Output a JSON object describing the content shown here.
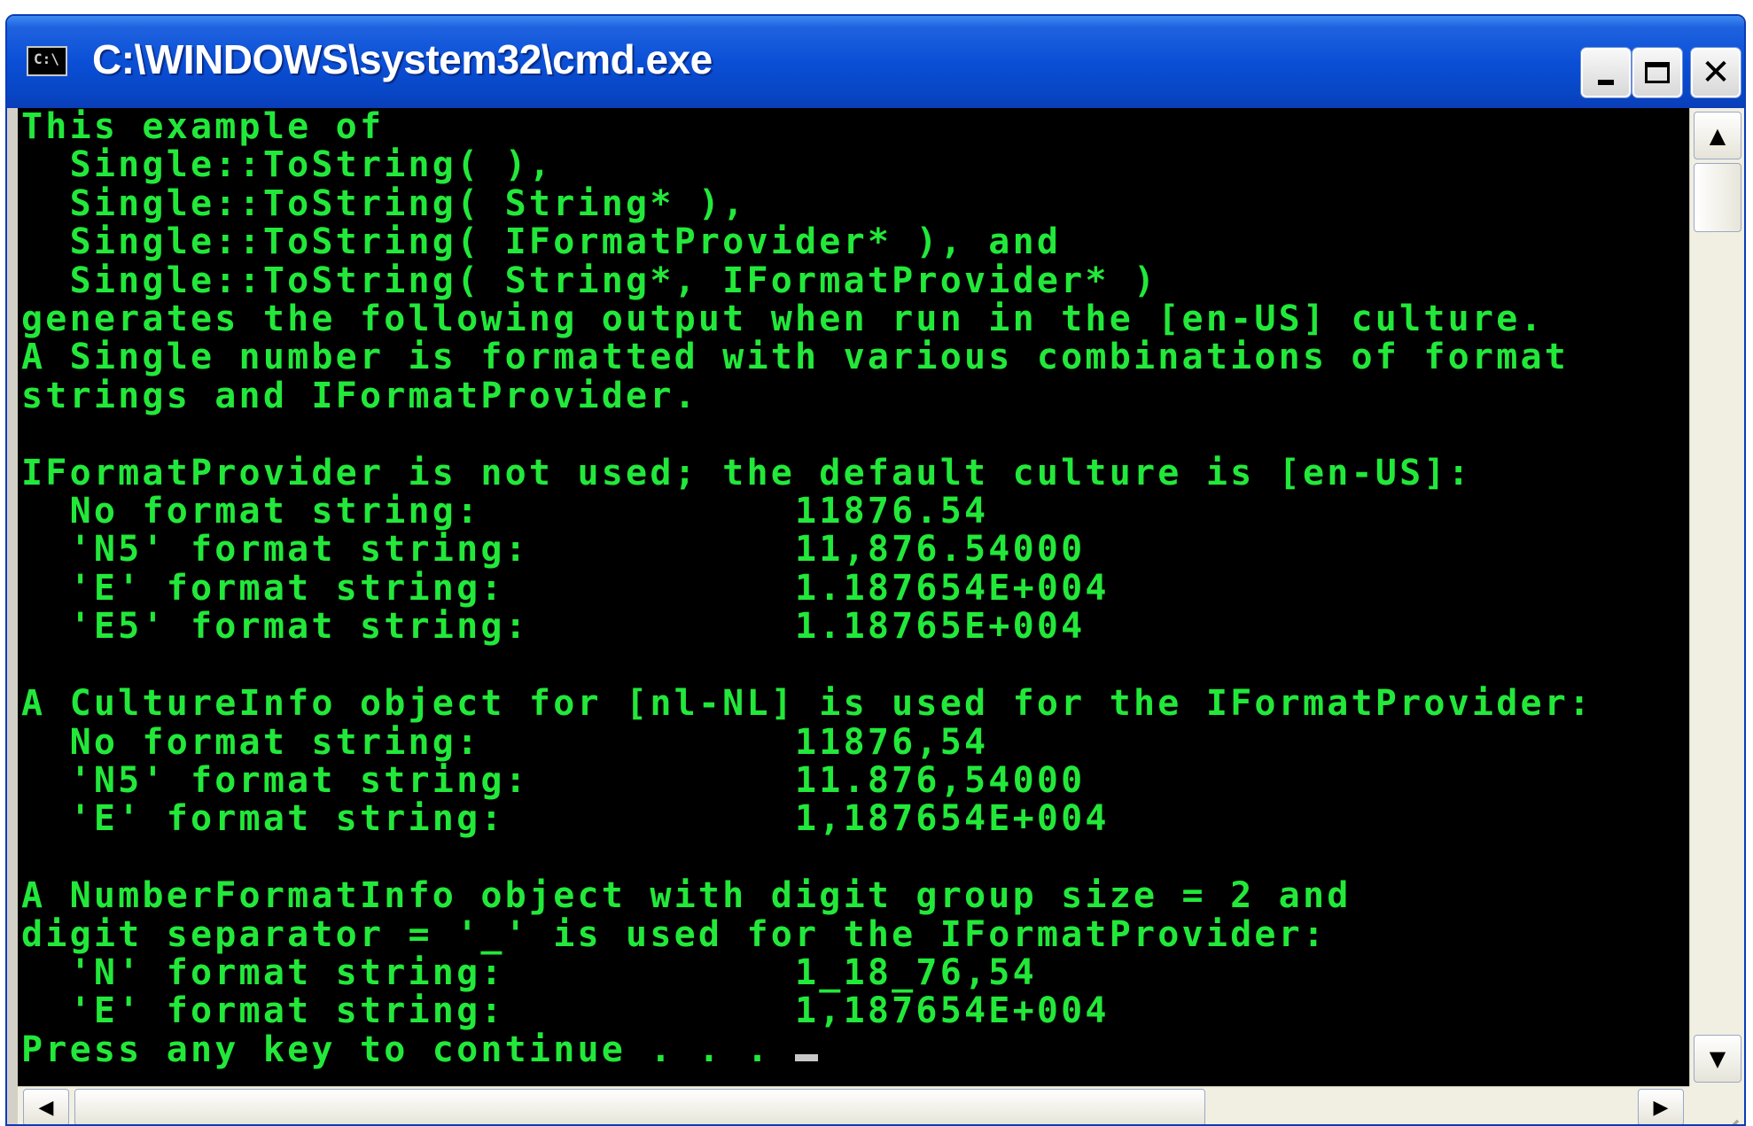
{
  "window": {
    "title": "C:\\WINDOWS\\system32\\cmd.exe",
    "icon_label": "C:\\",
    "controls": {
      "minimize": "minimize-icon",
      "maximize": "maximize-icon",
      "close": "close-icon"
    }
  },
  "console": {
    "text_color": "#22e83a",
    "background": "#000000",
    "lines": [
      "This example of",
      "  Single::ToString( ),",
      "  Single::ToString( String* ),",
      "  Single::ToString( IFormatProvider* ), and",
      "  Single::ToString( String*, IFormatProvider* )",
      "generates the following output when run in the [en-US] culture.",
      "A Single number is formatted with various combinations of format",
      "strings and IFormatProvider.",
      "",
      "IFormatProvider is not used; the default culture is [en-US]:",
      "  No format string:             11876.54",
      "  'N5' format string:           11,876.54000",
      "  'E' format string:            1.187654E+004",
      "  'E5' format string:           1.18765E+004",
      "",
      "A CultureInfo object for [nl-NL] is used for the IFormatProvider:",
      "  No format string:             11876,54",
      "  'N5' format string:           11.876,54000",
      "  'E' format string:            1,187654E+004",
      "",
      "A NumberFormatInfo object with digit group size = 2 and",
      "digit separator = '_' is used for the IFormatProvider:",
      "  'N' format string:            1_18_76,54",
      "  'E' format string:            1,187654E+004"
    ],
    "prompt": "Press any key to continue . . . "
  },
  "scrollbars": {
    "up_arrow": "▲",
    "down_arrow": "▼",
    "left_arrow": "◀",
    "right_arrow": "▶"
  }
}
